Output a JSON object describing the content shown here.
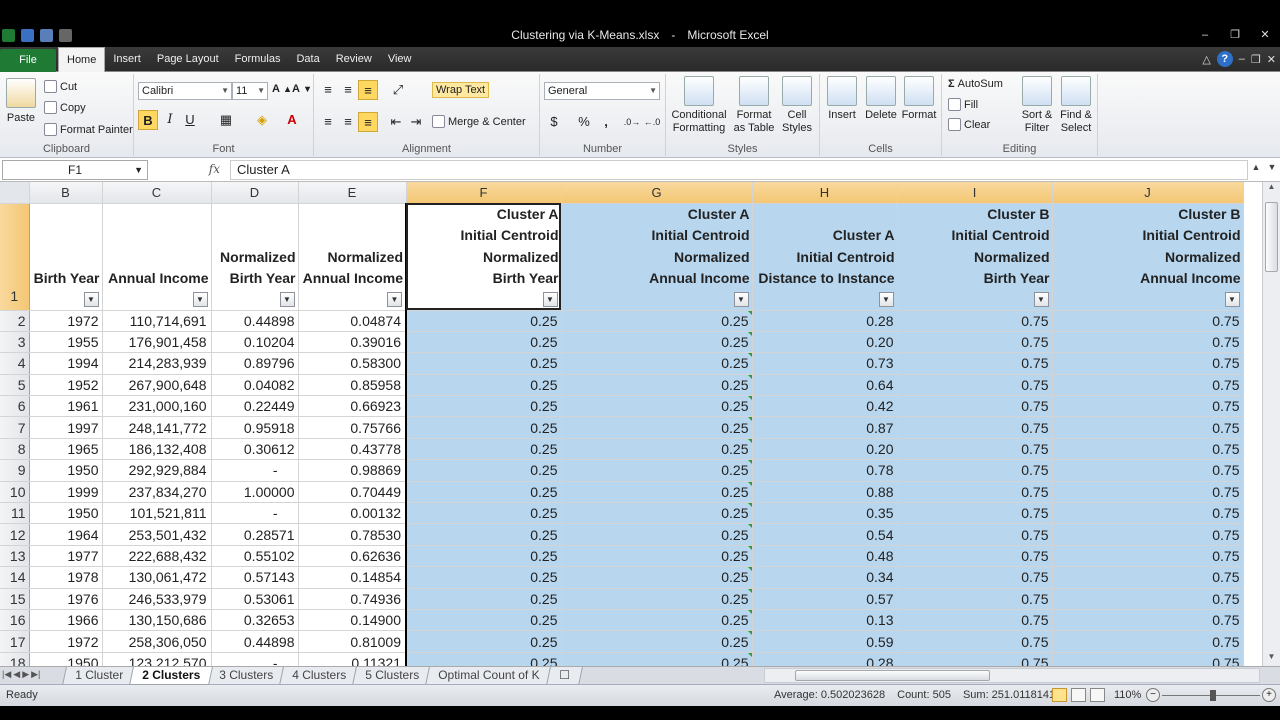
{
  "window": {
    "title_file": "Clustering via K-Means.xlsx",
    "title_app": "Microsoft Excel",
    "minimize": "–",
    "restore": "❐",
    "close": "✕"
  },
  "ribbon_tabs": {
    "file": "File",
    "tabs": [
      "Home",
      "Insert",
      "Page Layout",
      "Formulas",
      "Data",
      "Review",
      "View"
    ],
    "active": "Home"
  },
  "clipboard": {
    "paste": "Paste",
    "cut": "Cut",
    "copy": "Copy",
    "format_painter": "Format Painter",
    "label": "Clipboard"
  },
  "font": {
    "name": "Calibri",
    "size": "11",
    "bold": "B",
    "italic": "I",
    "underline": "U",
    "label": "Font"
  },
  "alignment": {
    "wrap_text": "Wrap Text",
    "merge_center": "Merge & Center",
    "label": "Alignment"
  },
  "number": {
    "format": "General",
    "currency": "$",
    "percent": "%",
    "comma": ",",
    "label": "Number"
  },
  "styles": {
    "conditional": "Conditional\nFormatting",
    "format_table": "Format\nas Table",
    "cell_styles": "Cell\nStyles",
    "label": "Styles"
  },
  "cells": {
    "insert": "Insert",
    "delete": "Delete",
    "format": "Format",
    "label": "Cells"
  },
  "editing": {
    "autosum": "AutoSum",
    "fill": "Fill",
    "clear": "Clear",
    "sort_filter": "Sort &\nFilter",
    "find_select": "Find &\nSelect",
    "label": "Editing"
  },
  "formula_bar": {
    "name_box": "F1",
    "fx": "fx",
    "content": "Cluster A"
  },
  "columns": [
    "B",
    "C",
    "D",
    "E",
    "F",
    "G",
    "H",
    "I",
    "J"
  ],
  "header_row": [
    [
      "Birth Year"
    ],
    [
      "Annual Income"
    ],
    [
      "Normalized",
      "Birth Year"
    ],
    [
      "Normalized",
      "Annual Income"
    ],
    [
      "Cluster A",
      "Initial Centroid",
      "Normalized",
      "Birth Year"
    ],
    [
      "Cluster A",
      "Initial Centroid",
      "Normalized",
      "Annual Income"
    ],
    [
      "Cluster A",
      "Initial Centroid",
      "Distance to Instance"
    ],
    [
      "Cluster B",
      "Initial Centroid",
      "Normalized",
      "Birth Year"
    ],
    [
      "Cluster B",
      "Initial Centroid",
      "Normalized",
      "Annual Income"
    ]
  ],
  "rows": [
    {
      "n": "2",
      "c": [
        "1972",
        "110,714,691",
        "0.44898",
        "0.04874",
        "0.25",
        "0.25",
        "0.28",
        "0.75",
        "0.75"
      ]
    },
    {
      "n": "3",
      "c": [
        "1955",
        "176,901,458",
        "0.10204",
        "0.39016",
        "0.25",
        "0.25",
        "0.20",
        "0.75",
        "0.75"
      ]
    },
    {
      "n": "4",
      "c": [
        "1994",
        "214,283,939",
        "0.89796",
        "0.58300",
        "0.25",
        "0.25",
        "0.73",
        "0.75",
        "0.75"
      ]
    },
    {
      "n": "5",
      "c": [
        "1952",
        "267,900,648",
        "0.04082",
        "0.85958",
        "0.25",
        "0.25",
        "0.64",
        "0.75",
        "0.75"
      ]
    },
    {
      "n": "6",
      "c": [
        "1961",
        "231,000,160",
        "0.22449",
        "0.66923",
        "0.25",
        "0.25",
        "0.42",
        "0.75",
        "0.75"
      ]
    },
    {
      "n": "7",
      "c": [
        "1997",
        "248,141,772",
        "0.95918",
        "0.75766",
        "0.25",
        "0.25",
        "0.87",
        "0.75",
        "0.75"
      ]
    },
    {
      "n": "8",
      "c": [
        "1965",
        "186,132,408",
        "0.30612",
        "0.43778",
        "0.25",
        "0.25",
        "0.20",
        "0.75",
        "0.75"
      ]
    },
    {
      "n": "9",
      "c": [
        "1950",
        "292,929,884",
        "-",
        "0.98869",
        "0.25",
        "0.25",
        "0.78",
        "0.75",
        "0.75"
      ]
    },
    {
      "n": "10",
      "c": [
        "1999",
        "237,834,270",
        "1.00000",
        "0.70449",
        "0.25",
        "0.25",
        "0.88",
        "0.75",
        "0.75"
      ]
    },
    {
      "n": "11",
      "c": [
        "1950",
        "101,521,811",
        "-",
        "0.00132",
        "0.25",
        "0.25",
        "0.35",
        "0.75",
        "0.75"
      ]
    },
    {
      "n": "12",
      "c": [
        "1964",
        "253,501,432",
        "0.28571",
        "0.78530",
        "0.25",
        "0.25",
        "0.54",
        "0.75",
        "0.75"
      ]
    },
    {
      "n": "13",
      "c": [
        "1977",
        "222,688,432",
        "0.55102",
        "0.62636",
        "0.25",
        "0.25",
        "0.48",
        "0.75",
        "0.75"
      ]
    },
    {
      "n": "14",
      "c": [
        "1978",
        "130,061,472",
        "0.57143",
        "0.14854",
        "0.25",
        "0.25",
        "0.34",
        "0.75",
        "0.75"
      ]
    },
    {
      "n": "15",
      "c": [
        "1976",
        "246,533,979",
        "0.53061",
        "0.74936",
        "0.25",
        "0.25",
        "0.57",
        "0.75",
        "0.75"
      ]
    },
    {
      "n": "16",
      "c": [
        "1966",
        "130,150,686",
        "0.32653",
        "0.14900",
        "0.25",
        "0.25",
        "0.13",
        "0.75",
        "0.75"
      ]
    },
    {
      "n": "17",
      "c": [
        "1972",
        "258,306,050",
        "0.44898",
        "0.81009",
        "0.25",
        "0.25",
        "0.59",
        "0.75",
        "0.75"
      ]
    },
    {
      "n": "18",
      "c": [
        "1950",
        "123,212,570",
        "-",
        "0.11321",
        "0.25",
        "0.25",
        "0.28",
        "0.75",
        "0.75"
      ]
    }
  ],
  "sheet_tabs": [
    "1 Cluster",
    "2 Clusters",
    "3 Clusters",
    "4 Clusters",
    "5 Clusters",
    "Optimal Count of K"
  ],
  "active_sheet": "2 Clusters",
  "status": {
    "ready": "Ready",
    "average": "Average: 0.502023628",
    "count": "Count: 505",
    "sum": "Sum: 251.0118141",
    "zoom": "110%"
  },
  "colors": {
    "selection_blue": "#b8d6ee",
    "file_tab": "#1f7a34",
    "selected_header": "#f3c774"
  }
}
